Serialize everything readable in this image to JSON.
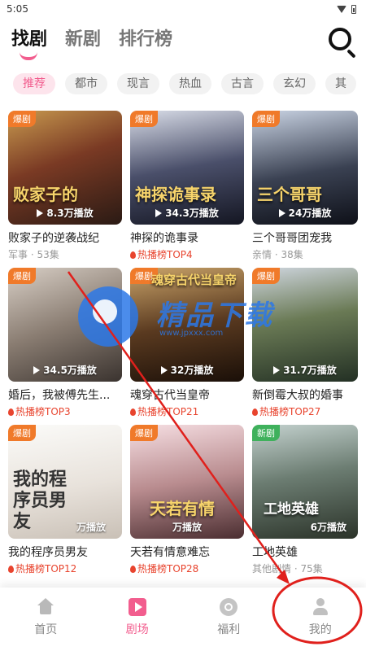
{
  "status_bar": {
    "time": "5:05"
  },
  "top_tabs": [
    {
      "label": "找剧",
      "active": true
    },
    {
      "label": "新剧",
      "active": false
    },
    {
      "label": "排行榜",
      "active": false
    }
  ],
  "categories": [
    "推荐",
    "都市",
    "现言",
    "热血",
    "古言",
    "玄幻",
    "其"
  ],
  "dramas": [
    {
      "title": "败家子的逆袭战纪",
      "plays": "8.3万播放",
      "badge": "爆剧",
      "sub": "军事 · 53集",
      "hot": false,
      "poster_text": "败家子的"
    },
    {
      "title": "神探的诡事录",
      "plays": "34.3万播放",
      "badge": "爆剧",
      "sub": "热播榜TOP4",
      "hot": true,
      "poster_text": "神探诡事录"
    },
    {
      "title": "三个哥哥团宠我",
      "plays": "24万播放",
      "badge": "爆剧",
      "sub": "亲情 · 38集",
      "hot": false,
      "poster_text": "三个哥哥"
    },
    {
      "title": "婚后，我被傅先生...",
      "plays": "34.5万播放",
      "badge": "爆剧",
      "sub": "热播榜TOP3",
      "hot": true,
      "poster_text": ""
    },
    {
      "title": "魂穿古代当皇帝",
      "plays": "32万播放",
      "badge": "爆剧",
      "sub": "热播榜TOP21",
      "hot": true,
      "poster_text": "魂穿古代当皇帝"
    },
    {
      "title": "新倒霉大叔的婚事",
      "plays": "31.7万播放",
      "badge": "爆剧",
      "sub": "热播榜TOP27",
      "hot": true,
      "poster_text": ""
    },
    {
      "title": "我的程序员男友",
      "plays": "万播放",
      "badge": "爆剧",
      "sub": "热播榜TOP12",
      "hot": true,
      "poster_text": "我的程序员男友"
    },
    {
      "title": "天若有情意难忘",
      "plays": "万播放",
      "badge": "爆剧",
      "sub": "热播榜TOP28",
      "hot": true,
      "poster_text": "天若有情"
    },
    {
      "title": "工地英雄",
      "plays": "6万播放",
      "badge": "新剧",
      "sub": "其他剧情 · 75集",
      "hot": false,
      "poster_text": "工地英雄"
    }
  ],
  "bottom_nav": [
    {
      "label": "首页",
      "icon": "home-icon",
      "active": false
    },
    {
      "label": "剧场",
      "icon": "play-icon",
      "active": true
    },
    {
      "label": "福利",
      "icon": "gift-icon",
      "active": false
    },
    {
      "label": "我的",
      "icon": "user-icon",
      "active": false
    }
  ],
  "watermark": {
    "brand": "精品下载",
    "url": "www.jpxxx.com"
  },
  "colors": {
    "accent": "#f25d8e",
    "hot": "#e8442e",
    "badge": "#f07a2a",
    "badge_new": "#3fb15c",
    "annotation": "#e0201c"
  }
}
